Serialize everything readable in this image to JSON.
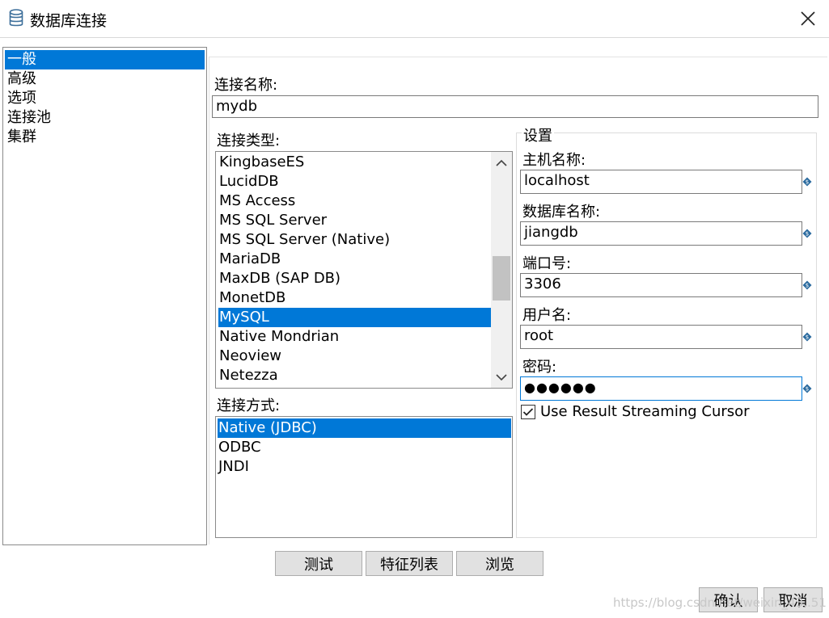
{
  "window": {
    "title": "数据库连接",
    "icons": {
      "title": "database-icon",
      "close": "close-icon"
    }
  },
  "nav": {
    "items": [
      {
        "label": "一般",
        "selected": true
      },
      {
        "label": "高级",
        "selected": false
      },
      {
        "label": "选项",
        "selected": false
      },
      {
        "label": "连接池",
        "selected": false
      },
      {
        "label": "集群",
        "selected": false
      }
    ]
  },
  "connection_name": {
    "label": "连接名称:",
    "value": "mydb"
  },
  "connection_type": {
    "label": "连接类型:",
    "items": [
      "KingbaseES",
      "LucidDB",
      "MS Access",
      "MS SQL Server",
      "MS SQL Server (Native)",
      "MariaDB",
      "MaxDB (SAP DB)",
      "MonetDB",
      "MySQL",
      "Native Mondrian",
      "Neoview",
      "Netezza"
    ],
    "selected": "MySQL"
  },
  "access_method": {
    "label": "连接方式:",
    "items": [
      "Native (JDBC)",
      "ODBC",
      "JNDI"
    ],
    "selected": "Native (JDBC)"
  },
  "settings": {
    "title": "设置",
    "host": {
      "label": "主机名称:",
      "value": "localhost"
    },
    "database": {
      "label": "数据库名称:",
      "value": "jiangdb"
    },
    "port": {
      "label": "端口号:",
      "value": "3306"
    },
    "username": {
      "label": "用户名:",
      "value": "root"
    },
    "password": {
      "label": "密码:",
      "value": "●●●●●●"
    },
    "streaming_cursor": {
      "label": "Use Result Streaming Cursor",
      "checked": true
    }
  },
  "buttons": {
    "test": "测试",
    "features": "特征列表",
    "browse": "浏览",
    "ok": "确认",
    "cancel": "取消"
  },
  "watermark": "https://blog.csdn.net/weixin_43..51",
  "colors": {
    "selection": "#0078d7",
    "button_bg": "#e1e1e1",
    "variable_icon": "#2a6a9e"
  }
}
